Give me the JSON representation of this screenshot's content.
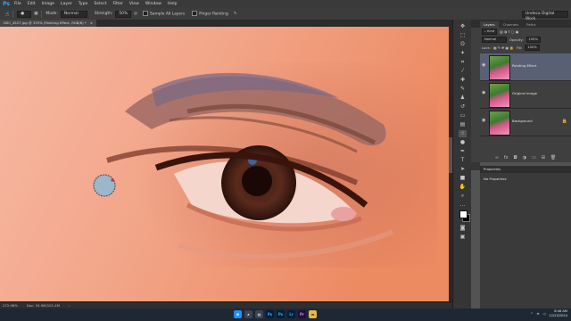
{
  "app": {
    "logo": "Ps"
  },
  "menubar": {
    "items": [
      "File",
      "Edit",
      "Image",
      "Layer",
      "Type",
      "Select",
      "Filter",
      "View",
      "Window",
      "Help"
    ]
  },
  "options": {
    "mode_label": "Mode:",
    "mode_value": "Normal",
    "strength_label": "Strength:",
    "strength_value": "50%",
    "sample_all_layers": "Sample All Layers",
    "finger_painting": "Finger Painting",
    "workspace": "Undeca Digital Work"
  },
  "document": {
    "tab_title": "DSC_4527.jpg @ 333% (Painting Effect, RGB/8) *",
    "zoom": "272.96%",
    "doc_size": "Doc: 34.9M/101.4M"
  },
  "layers_panel": {
    "tabs": [
      "Layers",
      "Channels",
      "Paths"
    ],
    "kind_label": "Kind",
    "blend_mode": "Normal",
    "opacity_label": "Opacity:",
    "opacity_value": "100%",
    "lock_label": "Lock:",
    "fill_label": "Fill:",
    "fill_value": "100%",
    "layers": [
      {
        "name": "Painting Effect",
        "selected": true
      },
      {
        "name": "Original Image",
        "selected": false
      },
      {
        "name": "Background",
        "selected": false
      }
    ]
  },
  "properties_panel": {
    "title": "Properties",
    "subtitle": "No Properties"
  },
  "taskbar": {
    "time": "8:46 AM",
    "date": "12/23/2024",
    "apps": [
      "win",
      "search",
      "files",
      "ps",
      "ps2",
      "lr",
      "pr",
      "folder"
    ]
  },
  "colors": {
    "accent": "#31a8ff",
    "selected_layer": "#5a6074",
    "panel_bg": "#3f3f3f"
  }
}
